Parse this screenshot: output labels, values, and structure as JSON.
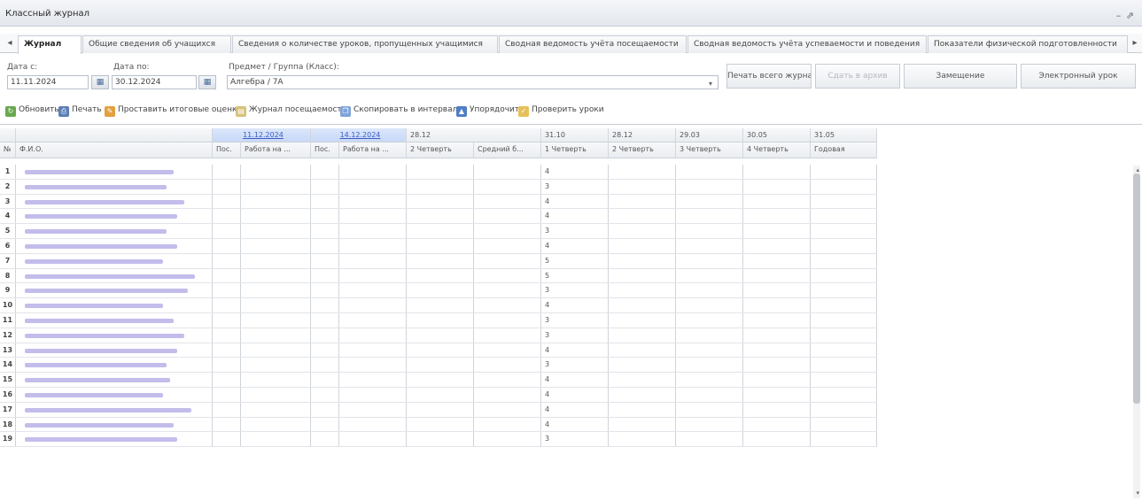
{
  "window": {
    "title": "Классный журнал",
    "controls": "– ⇗"
  },
  "tabs": [
    {
      "label": "Журнал",
      "active": true
    },
    {
      "label": "Общие сведения об учащихся",
      "active": false
    },
    {
      "label": "Сведения о количестве уроков, пропущенных учащимися",
      "active": false
    },
    {
      "label": "Сводная ведомость учёта посещаемости",
      "active": false
    },
    {
      "label": "Сводная ведомость учёта успеваемости и поведения",
      "active": false
    },
    {
      "label": "Показатели физической подготовленности",
      "active": false
    }
  ],
  "filters": {
    "date_from_label": "Дата с:",
    "date_from_value": "11.11.2024",
    "date_to_label": "Дата по:",
    "date_to_value": "30.12.2024",
    "subject_label": "Предмет / Группа (Класс):",
    "subject_value": "Алгебра / 7А"
  },
  "actions": {
    "print_blank": "Печать всего журнала",
    "disabled_action": "Сдать в архив",
    "substitution": "Замещение",
    "electronic": "Электронный урок"
  },
  "toolbar": {
    "refresh": "Обновить",
    "print": "Печать",
    "final_grades": "Проставить итоговые оценки",
    "attendance": "Журнал посещаемости",
    "copy_to_schedule": "Скопировать в интервал",
    "analyze": "Упорядочить",
    "check_homework": "Проверить уроки"
  },
  "grid": {
    "header_top": {
      "no": "",
      "name": "",
      "date1": "11.12.2024",
      "date2": "14.12.2024",
      "date3": "28.12",
      "date4": "31.10",
      "date5": "28.12",
      "date6": "29.03",
      "date7": "30.05",
      "date8": "31.05"
    },
    "header_sub": {
      "no": "№",
      "name": "Ф.И.О.",
      "att1": "Пос.",
      "work1": "Работа на ...",
      "att2": "Пос.",
      "work2": "Работа на ...",
      "q2": "2 Четверть",
      "extra": "Средний б...",
      "q1": "1 Четверть",
      "q2b": "2 Четверть",
      "q3": "3 Четверть",
      "q4": "4 Четверть",
      "year": "Годовая"
    },
    "rows": [
      {
        "n": "1",
        "name_width": 0.84,
        "q1": "4"
      },
      {
        "n": "2",
        "name_width": 0.8,
        "q1": "3"
      },
      {
        "n": "3",
        "name_width": 0.9,
        "q1": "4"
      },
      {
        "n": "4",
        "name_width": 0.86,
        "q1": "4"
      },
      {
        "n": "5",
        "name_width": 0.8,
        "q1": "3"
      },
      {
        "n": "6",
        "name_width": 0.86,
        "q1": "4"
      },
      {
        "n": "7",
        "name_width": 0.78,
        "q1": "5"
      },
      {
        "n": "8",
        "name_width": 0.96,
        "q1": "5"
      },
      {
        "n": "9",
        "name_width": 0.92,
        "q1": "3"
      },
      {
        "n": "10",
        "name_width": 0.78,
        "q1": "4"
      },
      {
        "n": "11",
        "name_width": 0.84,
        "q1": "3"
      },
      {
        "n": "12",
        "name_width": 0.9,
        "q1": "3"
      },
      {
        "n": "13",
        "name_width": 0.86,
        "q1": "4"
      },
      {
        "n": "14",
        "name_width": 0.8,
        "q1": "3"
      },
      {
        "n": "15",
        "name_width": 0.82,
        "q1": "4"
      },
      {
        "n": "16",
        "name_width": 0.78,
        "q1": "4"
      },
      {
        "n": "17",
        "name_width": 0.94,
        "q1": "4"
      },
      {
        "n": "18",
        "name_width": 0.84,
        "q1": "4"
      },
      {
        "n": "19",
        "name_width": 0.86,
        "q1": "3"
      }
    ]
  },
  "colors": {
    "accent": "#3a5cc4",
    "name_placeholder": "#b7b2e8"
  }
}
